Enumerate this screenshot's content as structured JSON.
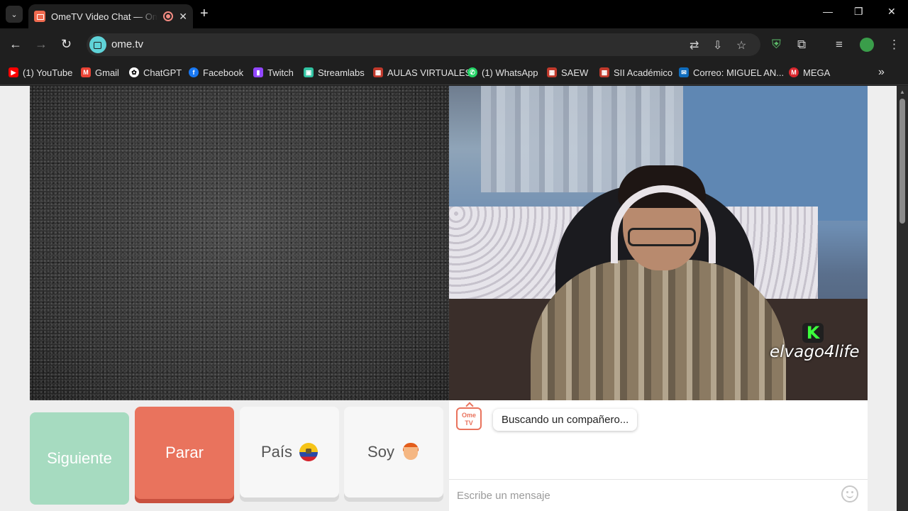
{
  "browser": {
    "tab_title": "OmeTV Video Chat — Omegle",
    "url": "ome.tv",
    "tab_close": "✕",
    "new_tab": "+",
    "window_controls": {
      "minimize": "—",
      "restore": "❐",
      "close": "✕"
    },
    "bookmarks": [
      {
        "label": "(1) YouTube",
        "icon": "youtube-icon",
        "color": "#ff0000"
      },
      {
        "label": "Gmail",
        "icon": "gmail-icon",
        "color": "#ea4335"
      },
      {
        "label": "ChatGPT",
        "icon": "chatgpt-icon",
        "color": "#ffffff"
      },
      {
        "label": "Facebook",
        "icon": "facebook-icon",
        "color": "#1877f2"
      },
      {
        "label": "Twitch",
        "icon": "twitch-icon",
        "color": "#9146ff"
      },
      {
        "label": "Streamlabs",
        "icon": "streamlabs-icon",
        "color": "#31c3a2"
      },
      {
        "label": "AULAS VIRTUALES",
        "icon": "aulas-icon",
        "color": "#c0392b"
      },
      {
        "label": "(1) WhatsApp",
        "icon": "whatsapp-icon",
        "color": "#25d366"
      },
      {
        "label": "SAEW",
        "icon": "saew-icon",
        "color": "#c0392b"
      },
      {
        "label": "SII Académico",
        "icon": "sii-icon",
        "color": "#c0392b"
      },
      {
        "label": "Correo: MIGUEL AN...",
        "icon": "outlook-icon",
        "color": "#0f6cbd"
      },
      {
        "label": "MEGA",
        "icon": "mega-icon",
        "color": "#d9272e"
      }
    ],
    "more_bookmarks": "»"
  },
  "video": {
    "watermark": "elvago4life",
    "watermark_logo": "K"
  },
  "controls": {
    "next_label": "Siguiente",
    "stop_label": "Parar",
    "country_label": "País",
    "gender_label": "Soy"
  },
  "chat": {
    "logo_line1": "Ome",
    "logo_line2": "TV",
    "status_message": "Buscando un compañero...",
    "input_placeholder": "Escribe un mensaje"
  },
  "colors": {
    "next": "#a6dbc0",
    "stop": "#e9735d",
    "accent": "#5fd3d8"
  }
}
